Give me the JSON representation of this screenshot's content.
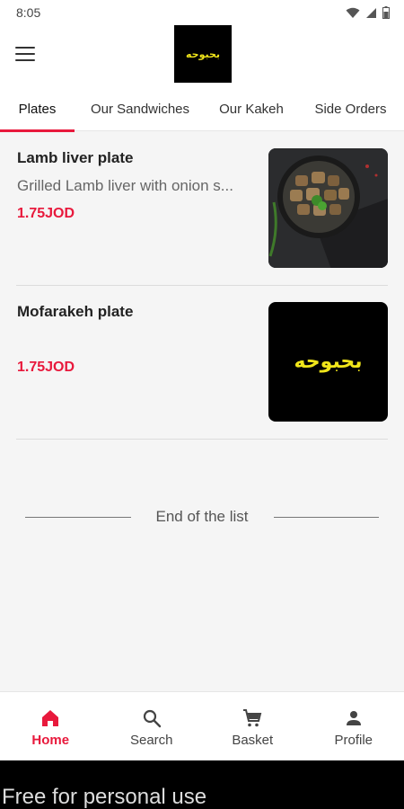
{
  "status_bar": {
    "time": "8:05"
  },
  "app_bar": {
    "logo_text": "بحبوحه"
  },
  "tabs": [
    {
      "label": "Plates",
      "active": true
    },
    {
      "label": "Our Sandwiches",
      "active": false
    },
    {
      "label": "Our Kakeh",
      "active": false
    },
    {
      "label": "Side Orders",
      "active": false
    }
  ],
  "items": [
    {
      "title": "Lamb liver plate",
      "description": "Grilled Lamb liver with onion s...",
      "price": "1.75JOD",
      "image": "lamb-liver-photo"
    },
    {
      "title": "Mofarakeh plate",
      "description": "",
      "price": "1.75JOD",
      "image_text": "بحبوحه"
    }
  ],
  "end_of_list": "End of the list",
  "bottom_nav": [
    {
      "label": "Home",
      "icon": "home-icon",
      "active": true
    },
    {
      "label": "Search",
      "icon": "search-icon",
      "active": false
    },
    {
      "label": "Basket",
      "icon": "cart-icon",
      "active": false
    },
    {
      "label": "Profile",
      "icon": "person-icon",
      "active": false
    }
  ],
  "watermark": "Free for personal use",
  "colors": {
    "accent": "#e8193c",
    "logo_yellow": "#f0e51a"
  }
}
